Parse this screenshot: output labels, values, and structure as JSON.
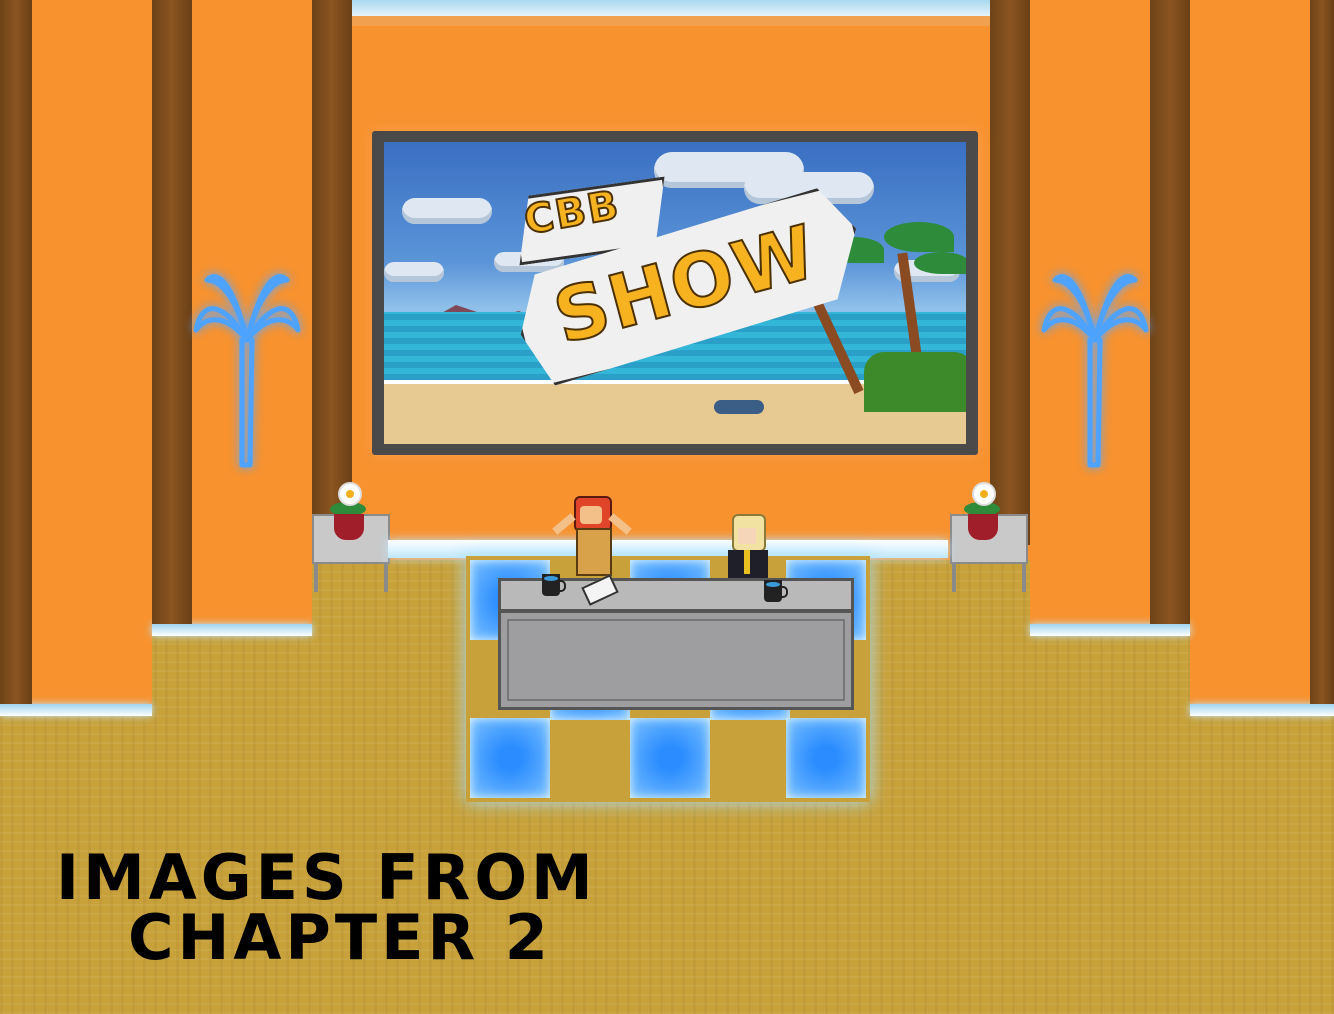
{
  "screen": {
    "logo_small": "CBB",
    "logo_big": "SHOW"
  },
  "caption": {
    "line1": "IMAGES FROM",
    "line2": "CHAPTER 2"
  },
  "colors": {
    "wall": "#f7922f",
    "floor": "#c8a13a",
    "pillar": "#7a4a1a",
    "neon": "#5aa8ff",
    "tile_glow": "#2a8cff",
    "logo_yellow": "#f6b21f"
  },
  "icons": [
    "neon-palm-tree-icon",
    "flower-pot-icon",
    "mug-icon",
    "papers-icon"
  ]
}
